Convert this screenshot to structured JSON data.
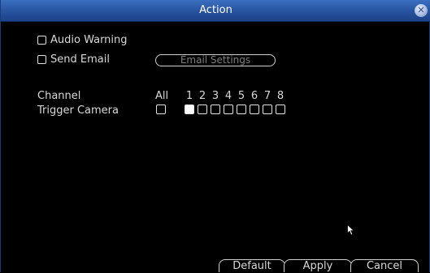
{
  "window": {
    "title": "Action",
    "close_glyph": "✕"
  },
  "options": {
    "audio_warning": {
      "label": "Audio Warning",
      "checked": false
    },
    "send_email": {
      "label": "Send Email",
      "checked": false
    }
  },
  "email_settings_label": "Email Settings",
  "channel_label": "Channel",
  "trigger_camera_label": "Trigger Camera",
  "all_label": "All",
  "channels": [
    "1",
    "2",
    "3",
    "4",
    "5",
    "6",
    "7",
    "8"
  ],
  "trigger_checked": [
    true,
    false,
    false,
    false,
    false,
    false,
    false,
    false
  ],
  "trigger_all_checked": false,
  "footer": {
    "default_label": "Default",
    "apply_label": "Apply",
    "cancel_label": "Cancel"
  },
  "colors": {
    "titlebar": "#2a57a4",
    "background": "#000000",
    "text": "#d8d8d8",
    "disabled_text": "#7d7d7d"
  }
}
